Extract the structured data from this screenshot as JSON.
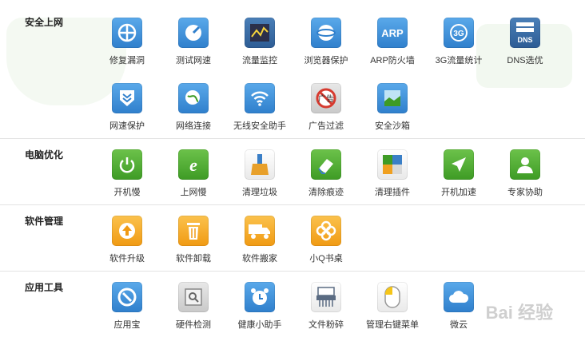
{
  "sections": [
    {
      "title": "安全上网",
      "items": [
        {
          "label": "修复漏洞",
          "icon": "repair-icon"
        },
        {
          "label": "测试网速",
          "icon": "speedometer-icon"
        },
        {
          "label": "流量监控",
          "icon": "chart-monitor-icon"
        },
        {
          "label": "浏览器保护",
          "icon": "browser-shield-icon"
        },
        {
          "label": "ARP防火墙",
          "icon": "arp-icon"
        },
        {
          "label": "3G流量统计",
          "icon": "3g-icon"
        },
        {
          "label": "DNS选优",
          "icon": "dns-icon"
        },
        {
          "label": "网速保护",
          "icon": "chevron-shield-icon"
        },
        {
          "label": "网络连接",
          "icon": "globe-link-icon"
        },
        {
          "label": "无线安全助手",
          "icon": "wifi-icon"
        },
        {
          "label": "广告过滤",
          "icon": "ad-block-icon"
        },
        {
          "label": "安全沙箱",
          "icon": "sandbox-icon"
        }
      ]
    },
    {
      "title": "电脑优化",
      "items": [
        {
          "label": "开机慢",
          "icon": "power-icon"
        },
        {
          "label": "上网慢",
          "icon": "ie-icon"
        },
        {
          "label": "清理垃圾",
          "icon": "broom-icon"
        },
        {
          "label": "清除痕迹",
          "icon": "eraser-icon"
        },
        {
          "label": "清理插件",
          "icon": "puzzle-icon"
        },
        {
          "label": "开机加速",
          "icon": "rocket-icon"
        },
        {
          "label": "专家协助",
          "icon": "expert-icon"
        }
      ]
    },
    {
      "title": "软件管理",
      "items": [
        {
          "label": "软件升级",
          "icon": "upgrade-arrow-icon"
        },
        {
          "label": "软件卸载",
          "icon": "trash-icon"
        },
        {
          "label": "软件搬家",
          "icon": "truck-icon"
        },
        {
          "label": "小Q书桌",
          "icon": "clover-icon"
        }
      ]
    },
    {
      "title": "应用工具",
      "items": [
        {
          "label": "应用宝",
          "icon": "app-store-icon"
        },
        {
          "label": "硬件检测",
          "icon": "hardware-check-icon"
        },
        {
          "label": "健康小助手",
          "icon": "alarm-clock-icon"
        },
        {
          "label": "文件粉碎",
          "icon": "shredder-icon"
        },
        {
          "label": "管理右键菜单",
          "icon": "mouse-icon"
        },
        {
          "label": "微云",
          "icon": "cloud-icon"
        }
      ]
    }
  ],
  "watermark": "Bai 经验"
}
